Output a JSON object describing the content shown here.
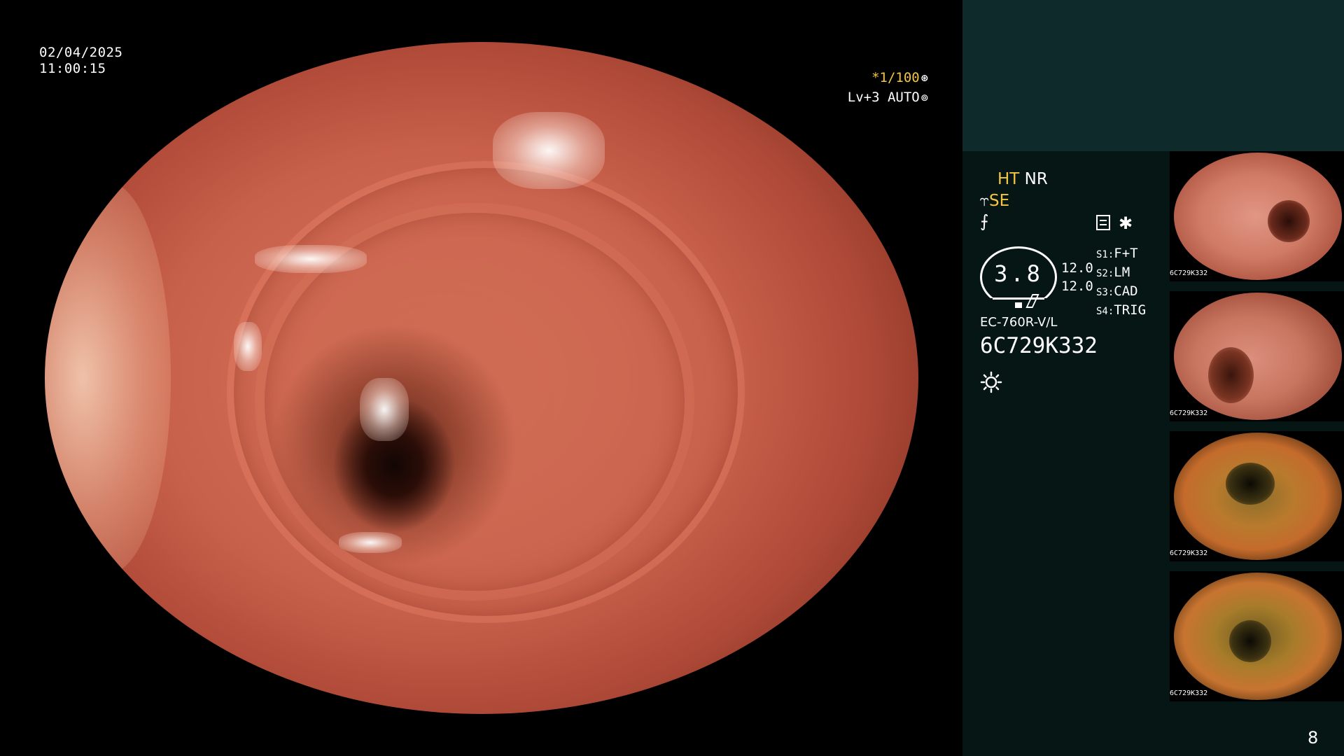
{
  "overlay": {
    "date": "02/04/2025",
    "time": "11:00:15",
    "shutter_prefix": "*",
    "shutter": "1/100",
    "level": "Lv+3",
    "iris": "AUTO"
  },
  "status": {
    "ht": "HT",
    "nr": "NR",
    "se": "SE"
  },
  "gauge": {
    "value": "3.8"
  },
  "settings": {
    "values": [
      "12.0",
      "12.0"
    ],
    "switches": [
      {
        "key": "S1:",
        "value": "F+T"
      },
      {
        "key": "S2:",
        "value": "LM"
      },
      {
        "key": "S3:",
        "value": "CAD"
      },
      {
        "key": "S4:",
        "value": "TRIG"
      }
    ]
  },
  "scope": {
    "model": "EC-760R-V/L",
    "serial": "6C729K332"
  },
  "thumbnails": [
    {
      "serial": "6C729K332"
    },
    {
      "serial": "6C729K332"
    },
    {
      "serial": "6C729K332"
    },
    {
      "serial": "6C729K332"
    }
  ],
  "page_number": "8",
  "colors": {
    "accent_yellow": "#f4c542",
    "panel_top": "#0f2a2b",
    "panel_body": "#061615"
  }
}
